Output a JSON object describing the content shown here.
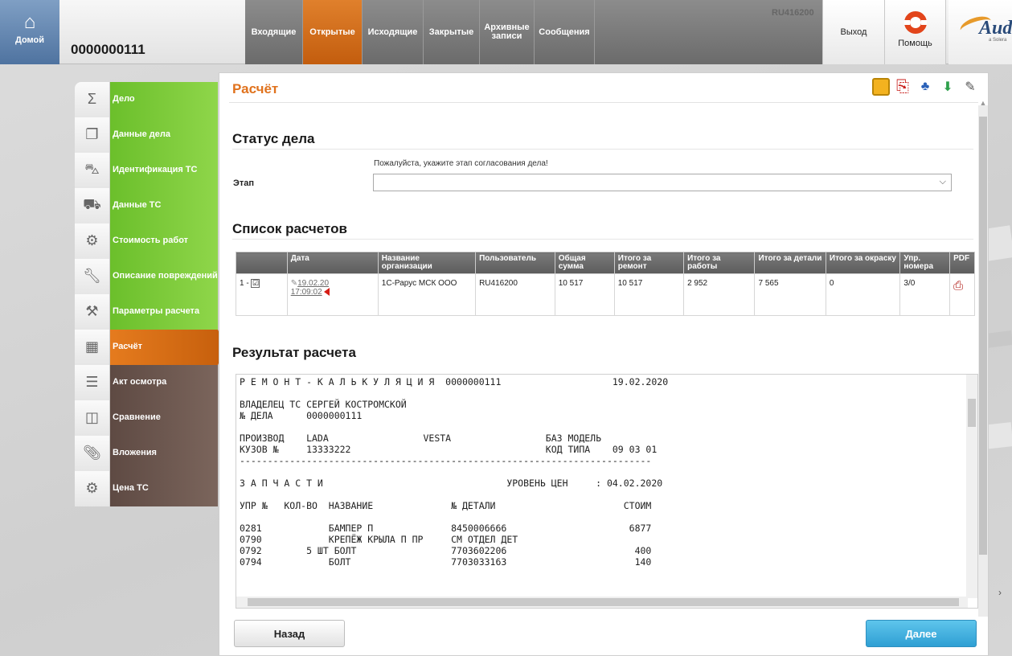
{
  "header": {
    "home_label": "Домой",
    "case_number": "0000000111",
    "user_id": "RU416200",
    "logout_label": "Выход",
    "help_label": "Помощь",
    "brand_text": "Aud",
    "brand_sub": "a Solera",
    "tabs": [
      {
        "label": "Входящие",
        "active": false
      },
      {
        "label": "Открытые",
        "active": true
      },
      {
        "label": "Исходящие",
        "active": false
      },
      {
        "label": "Закрытые",
        "active": false
      },
      {
        "label": "Архивные записи",
        "active": false
      },
      {
        "label": "Сообщения",
        "active": false
      }
    ]
  },
  "sidebar": {
    "items": [
      {
        "label": "Дело",
        "icon": "sigma-icon",
        "state": "green"
      },
      {
        "label": "Данные дела",
        "icon": "documents-icon",
        "state": "green"
      },
      {
        "label": "Идентификация ТС",
        "icon": "car-id-icon",
        "state": "green"
      },
      {
        "label": "Данные ТС",
        "icon": "car-icon",
        "state": "green"
      },
      {
        "label": "Стоимость работ",
        "icon": "gears-icon",
        "state": "green"
      },
      {
        "label": "Описание повреждений",
        "icon": "wrench-icon",
        "state": "green"
      },
      {
        "label": "Параметры расчета",
        "icon": "hammer-icon",
        "state": "green"
      },
      {
        "label": "Расчёт",
        "icon": "calculator-icon",
        "state": "active"
      },
      {
        "label": "Акт осмотра",
        "icon": "report-icon",
        "state": "brown"
      },
      {
        "label": "Сравнение",
        "icon": "compare-icon",
        "state": "brown"
      },
      {
        "label": "Вложения",
        "icon": "paperclip-icon",
        "state": "brown"
      },
      {
        "label": "Цена ТС",
        "icon": "gears-icon",
        "state": "brown"
      }
    ]
  },
  "main": {
    "title": "Расчёт",
    "status_section": {
      "heading": "Статус дела",
      "hint": "Пожалуйста, укажите этап согласования дела!",
      "stage_label": "Этап",
      "stage_value": ""
    },
    "calc_list": {
      "heading": "Список расчетов",
      "columns": [
        "",
        "Дата",
        "Название организации",
        "Пользователь",
        "Общая сумма",
        "Итого за ремонт",
        "Итого за работы",
        "Итого за детали",
        "Итого за окраску",
        "Упр. номера",
        "PDF"
      ],
      "rows": [
        {
          "index": "1 -",
          "checked": "☑",
          "date": "19.02.20",
          "time": "17:09:02",
          "org": "1С-Рарус МСК ООО",
          "user": "RU416200",
          "total": "10 517",
          "repair": "10 517",
          "labor": "2 952",
          "parts": "7 565",
          "paint": "0",
          "control": "3/0"
        }
      ]
    },
    "result": {
      "heading": "Результат расчета",
      "lines": [
        "Р Е М О Н Т - К А Л Ь К У Л Я Ц И Я  0000000111                    19.02.2020",
        "",
        "ВЛАДЕЛЕЦ ТС СЕРГЕЙ КОСТРОМСКОЙ",
        "№ ДЕЛА      0000000111",
        "",
        "ПРОИЗВОД    LADA                 VESTA                 БАЗ МОДЕЛЬ",
        "КУЗОВ №     13333222                                   КОД ТИПА    09 03 01",
        "--------------------------------------------------------------------------",
        "",
        "З А П Ч А С Т И                                 УРОВЕНЬ ЦЕН     : 04.02.2020",
        "",
        "УПР №   КОЛ-ВО  НАЗВАНИЕ              № ДЕТАЛИ                       СТОИМ",
        "",
        "0281            БАМПЕР П              8450006666                      6877",
        "0790            КРЕПЁЖ КРЫЛА П ПР     СМ ОТДЕЛ ДЕТ",
        "0792        5 ШТ БОЛТ                 7703602206                       400",
        "0794            БОЛТ                  7703033163                       140"
      ]
    },
    "back_label": "Назад",
    "next_label": "Далее"
  }
}
